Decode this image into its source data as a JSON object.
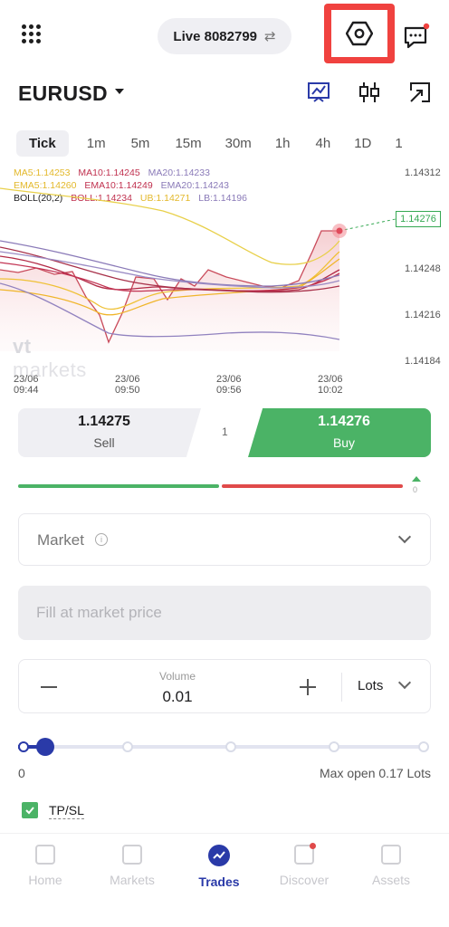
{
  "header": {
    "account_label": "Live 8082799",
    "swap_icon": "⇄"
  },
  "symbol": {
    "name": "EURUSD"
  },
  "timeframes": [
    "Tick",
    "1m",
    "5m",
    "15m",
    "30m",
    "1h",
    "4h",
    "1D",
    "1"
  ],
  "chart": {
    "legend_row1": [
      {
        "text": "MA5:1.14253",
        "color": "#e3b82a"
      },
      {
        "text": "MA10:1.14245",
        "color": "#c0314f"
      },
      {
        "text": "MA20:1.14233",
        "color": "#8a7ab8"
      }
    ],
    "legend_row2": [
      {
        "text": "EMA5:1.14260",
        "color": "#e3b82a"
      },
      {
        "text": "EMA10:1.14249",
        "color": "#c0314f"
      },
      {
        "text": "EMA20:1.14243",
        "color": "#8a7ab8"
      }
    ],
    "legend_row3": [
      {
        "text": "BOLL(20,2)",
        "color": "#1d1d1f"
      },
      {
        "text": "BOLL:1.14234",
        "color": "#c0314f"
      },
      {
        "text": "UB:1.14271",
        "color": "#e3b82a"
      },
      {
        "text": "LB:1.14196",
        "color": "#8a7ab8"
      }
    ],
    "price_ticks": [
      "1.14312",
      "1.14248",
      "1.14216",
      "1.14184"
    ],
    "current_price": "1.14276",
    "time_ticks": [
      "23/06 09:44",
      "23/06 09:50",
      "23/06 09:56",
      "23/06 10:02"
    ],
    "watermark_bold": "vt",
    "watermark_light": " markets"
  },
  "trade": {
    "sell_price": "1.14275",
    "sell_label": "Sell",
    "spread": "1",
    "buy_price": "1.14276",
    "buy_label": "Buy",
    "sentiment_value": "0"
  },
  "order": {
    "type_label": "Market",
    "price_placeholder": "Fill at market price",
    "volume_label": "Volume",
    "volume_value": "0.01",
    "unit_label": "Lots",
    "slider_min": "0",
    "slider_max": "Max open 0.17 Lots",
    "tpsl_label": "TP/SL"
  },
  "nav": {
    "home": "Home",
    "markets": "Markets",
    "trades": "Trades",
    "discover": "Discover",
    "assets": "Assets"
  },
  "colors": {
    "buy": "#4bb366",
    "sell_bar": "#e04a4a",
    "accent": "#2a3aa8",
    "highlight": "#f0423f"
  }
}
